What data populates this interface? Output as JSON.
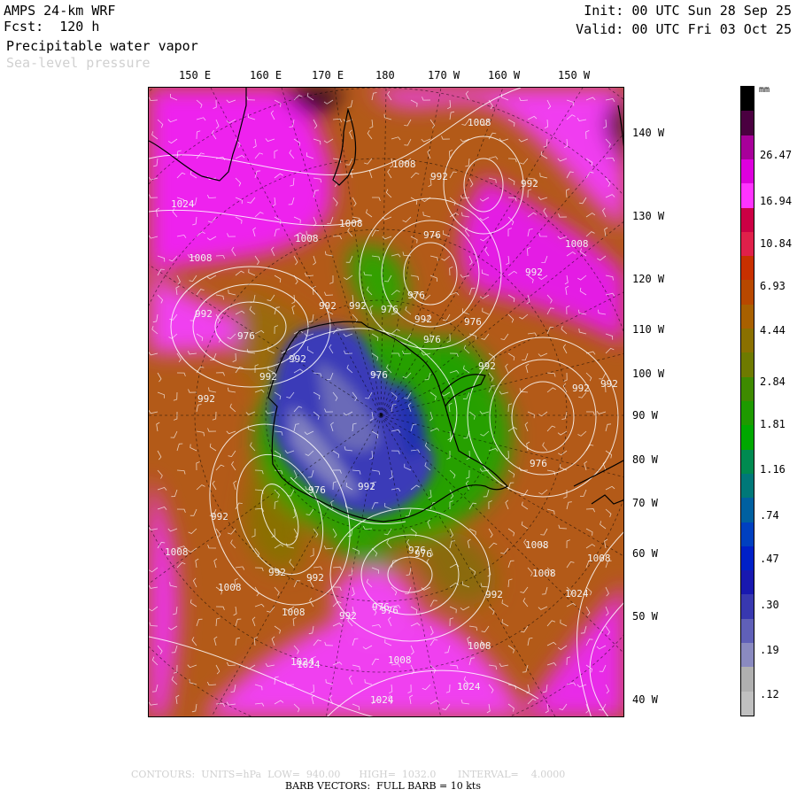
{
  "header": {
    "model": "AMPS 24-km WRF",
    "forecast": "Fcst:  120 h",
    "field": "Precipitable water vapor",
    "overlay": "Sea-level pressure",
    "init": "Init: 00 UTC Sun 28 Sep 25",
    "valid": "Valid: 00 UTC Fri 03 Oct 25"
  },
  "top_axis_labels": [
    "150 E",
    "160 E",
    "170 E",
    "180",
    "170 W",
    "160 W",
    "150 W"
  ],
  "right_axis_labels": [
    "140 W",
    "130 W",
    "120 W",
    "110 W",
    "100 W",
    "90 W",
    "80 W",
    "70 W",
    "60 W",
    "50 W",
    "40 W"
  ],
  "colorbar": {
    "unit": "mm",
    "labels": [
      "26.47",
      "16.94",
      "10.84",
      "6.93",
      "4.44",
      "2.84",
      "1.81",
      "1.16",
      ".74",
      ".47",
      ".30",
      ".19",
      ".12"
    ],
    "colors": [
      "#000000",
      "#4a0040",
      "#a8009a",
      "#dd00dd",
      "#ff33ff",
      "#cc0044",
      "#e0204a",
      "#c83000",
      "#b84800",
      "#a86000",
      "#8a7000",
      "#6e7a00",
      "#3e8a00",
      "#1e9a00",
      "#00a800",
      "#008a50",
      "#007878",
      "#0060a0",
      "#0040c0",
      "#0020c8",
      "#1818b0",
      "#3838b0",
      "#6060b8",
      "#8a8ac0",
      "#b0b0b0",
      "#c0c0c0"
    ]
  },
  "isobar_labels": [
    "1008",
    "1008",
    "992",
    "1024",
    "1008",
    "1008",
    "1008",
    "992",
    "976",
    "976",
    "992",
    "976",
    "992",
    "992",
    "992",
    "976",
    "992",
    "992",
    "1008",
    "992",
    "976",
    "976",
    "992",
    "976",
    "992",
    "992",
    "992",
    "976",
    "1008",
    "1008",
    "992",
    "976",
    "992",
    "976",
    "1008",
    "1024",
    "992",
    "992",
    "1008",
    "976",
    "1008",
    "1024",
    "1008",
    "1008",
    "1024",
    "1024",
    "1024",
    "976",
    "992",
    "976",
    "992",
    "1008"
  ],
  "footer": {
    "contours": "CONTOURS:  UNITS=hPa  LOW=  940.00      HIGH=  1032.0       INTERVAL=    4.0000",
    "barbs": "BARB VECTORS:  FULL BARB = 10 kts"
  }
}
